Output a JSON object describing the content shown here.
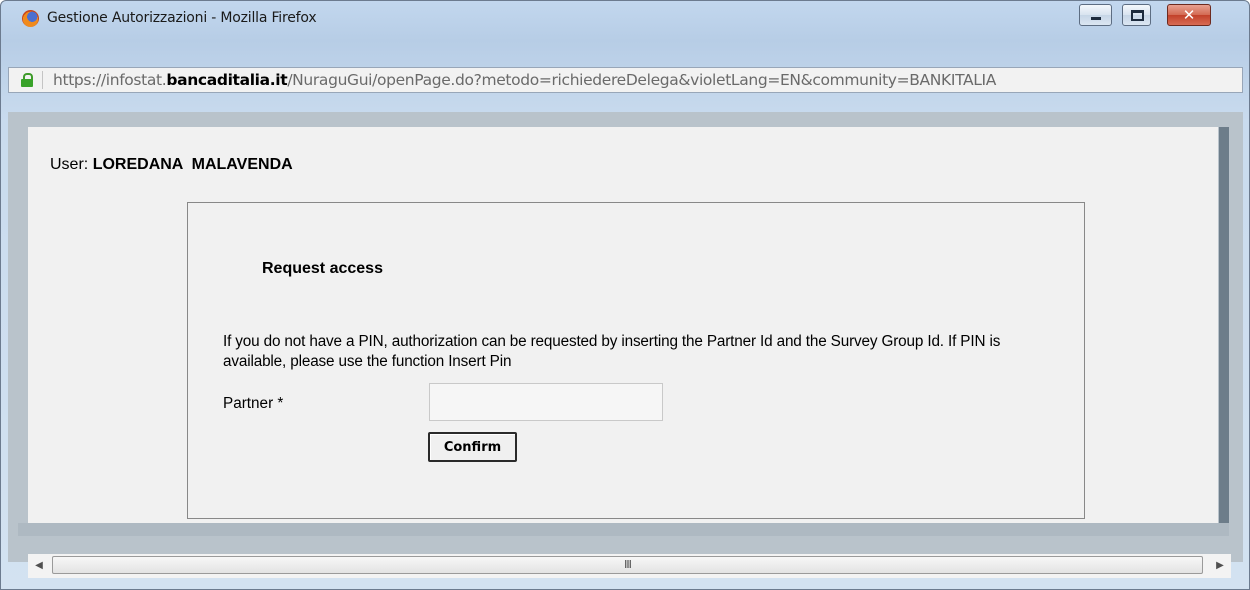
{
  "window": {
    "title": "Gestione Autorizzazioni - Mozilla Firefox",
    "controls": {
      "minimize": "",
      "maximize": "",
      "close": "✕"
    }
  },
  "address_bar": {
    "url_prefix": "https://infostat.",
    "url_domain": "bancaditalia.it",
    "url_path": "/NuraguGui/openPage.do?metodo=richiedereDelega&violetLang=EN&community=BANKITALIA",
    "icon": "lock-icon"
  },
  "page": {
    "user_label": "User:",
    "user_name": "LOREDANA  MALAVENDA",
    "request": {
      "title": "Request access",
      "description": "If you do not have a PIN, authorization can be requested by inserting the Partner Id and the Survey Group Id. If PIN is available, please use the function Insert Pin",
      "partner_label": "Partner *",
      "partner_value": "",
      "confirm_label": "Confirm"
    }
  },
  "scrollbar": {
    "left_arrow": "◀",
    "right_arrow": "▶",
    "grip": "III"
  },
  "colors": {
    "frame": "#c2d7ee",
    "content_bg": "#f1f1f1",
    "close_button": "#d36a53",
    "lock": "#39a22a"
  }
}
